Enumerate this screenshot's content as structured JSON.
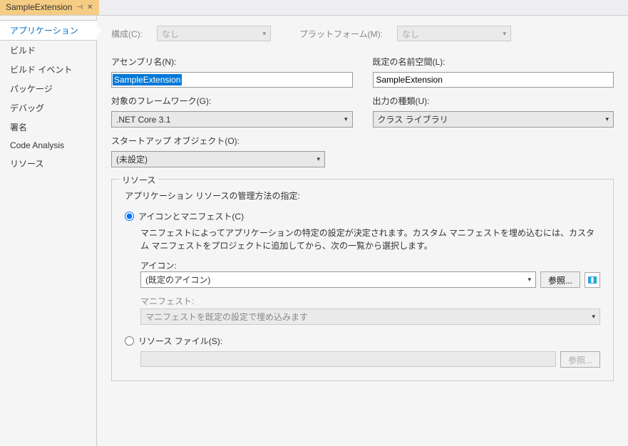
{
  "tab": {
    "title": "SampleExtension"
  },
  "sidebar": {
    "items": [
      "アプリケーション",
      "ビルド",
      "ビルド イベント",
      "パッケージ",
      "デバッグ",
      "署名",
      "Code Analysis",
      "リソース"
    ]
  },
  "topbar": {
    "config_label": "構成(C):",
    "config_value": "なし",
    "platform_label": "プラットフォーム(M):",
    "platform_value": "なし"
  },
  "fields": {
    "assembly_label": "アセンブリ名(N):",
    "assembly_value": "SampleExtension",
    "namespace_label": "既定の名前空間(L):",
    "namespace_value": "SampleExtension",
    "framework_label": "対象のフレームワーク(G):",
    "framework_value": ".NET Core 3.1",
    "output_label": "出力の種類(U):",
    "output_value": "クラス ライブラリ",
    "startup_label": "スタートアップ オブジェクト(O):",
    "startup_value": "(未設定)"
  },
  "resources": {
    "legend": "リソース",
    "desc": "アプリケーション リソースの管理方法の指定:",
    "radio_icon_label": "アイコンとマニフェスト(C)",
    "manifest_hint": "マニフェストによってアプリケーションの特定の設定が決定されます。カスタム マニフェストを埋め込むには、カスタム マニフェストをプロジェクトに追加してから、次の一覧から選択します。",
    "icon_label": "アイコン:",
    "icon_value": "(既定のアイコン)",
    "browse_label": "参照...",
    "manifest_label": "マニフェスト:",
    "manifest_value": "マニフェストを既定の設定で埋め込みます",
    "radio_file_label": "リソース ファイル(S):",
    "browse2_label": "参照..."
  }
}
